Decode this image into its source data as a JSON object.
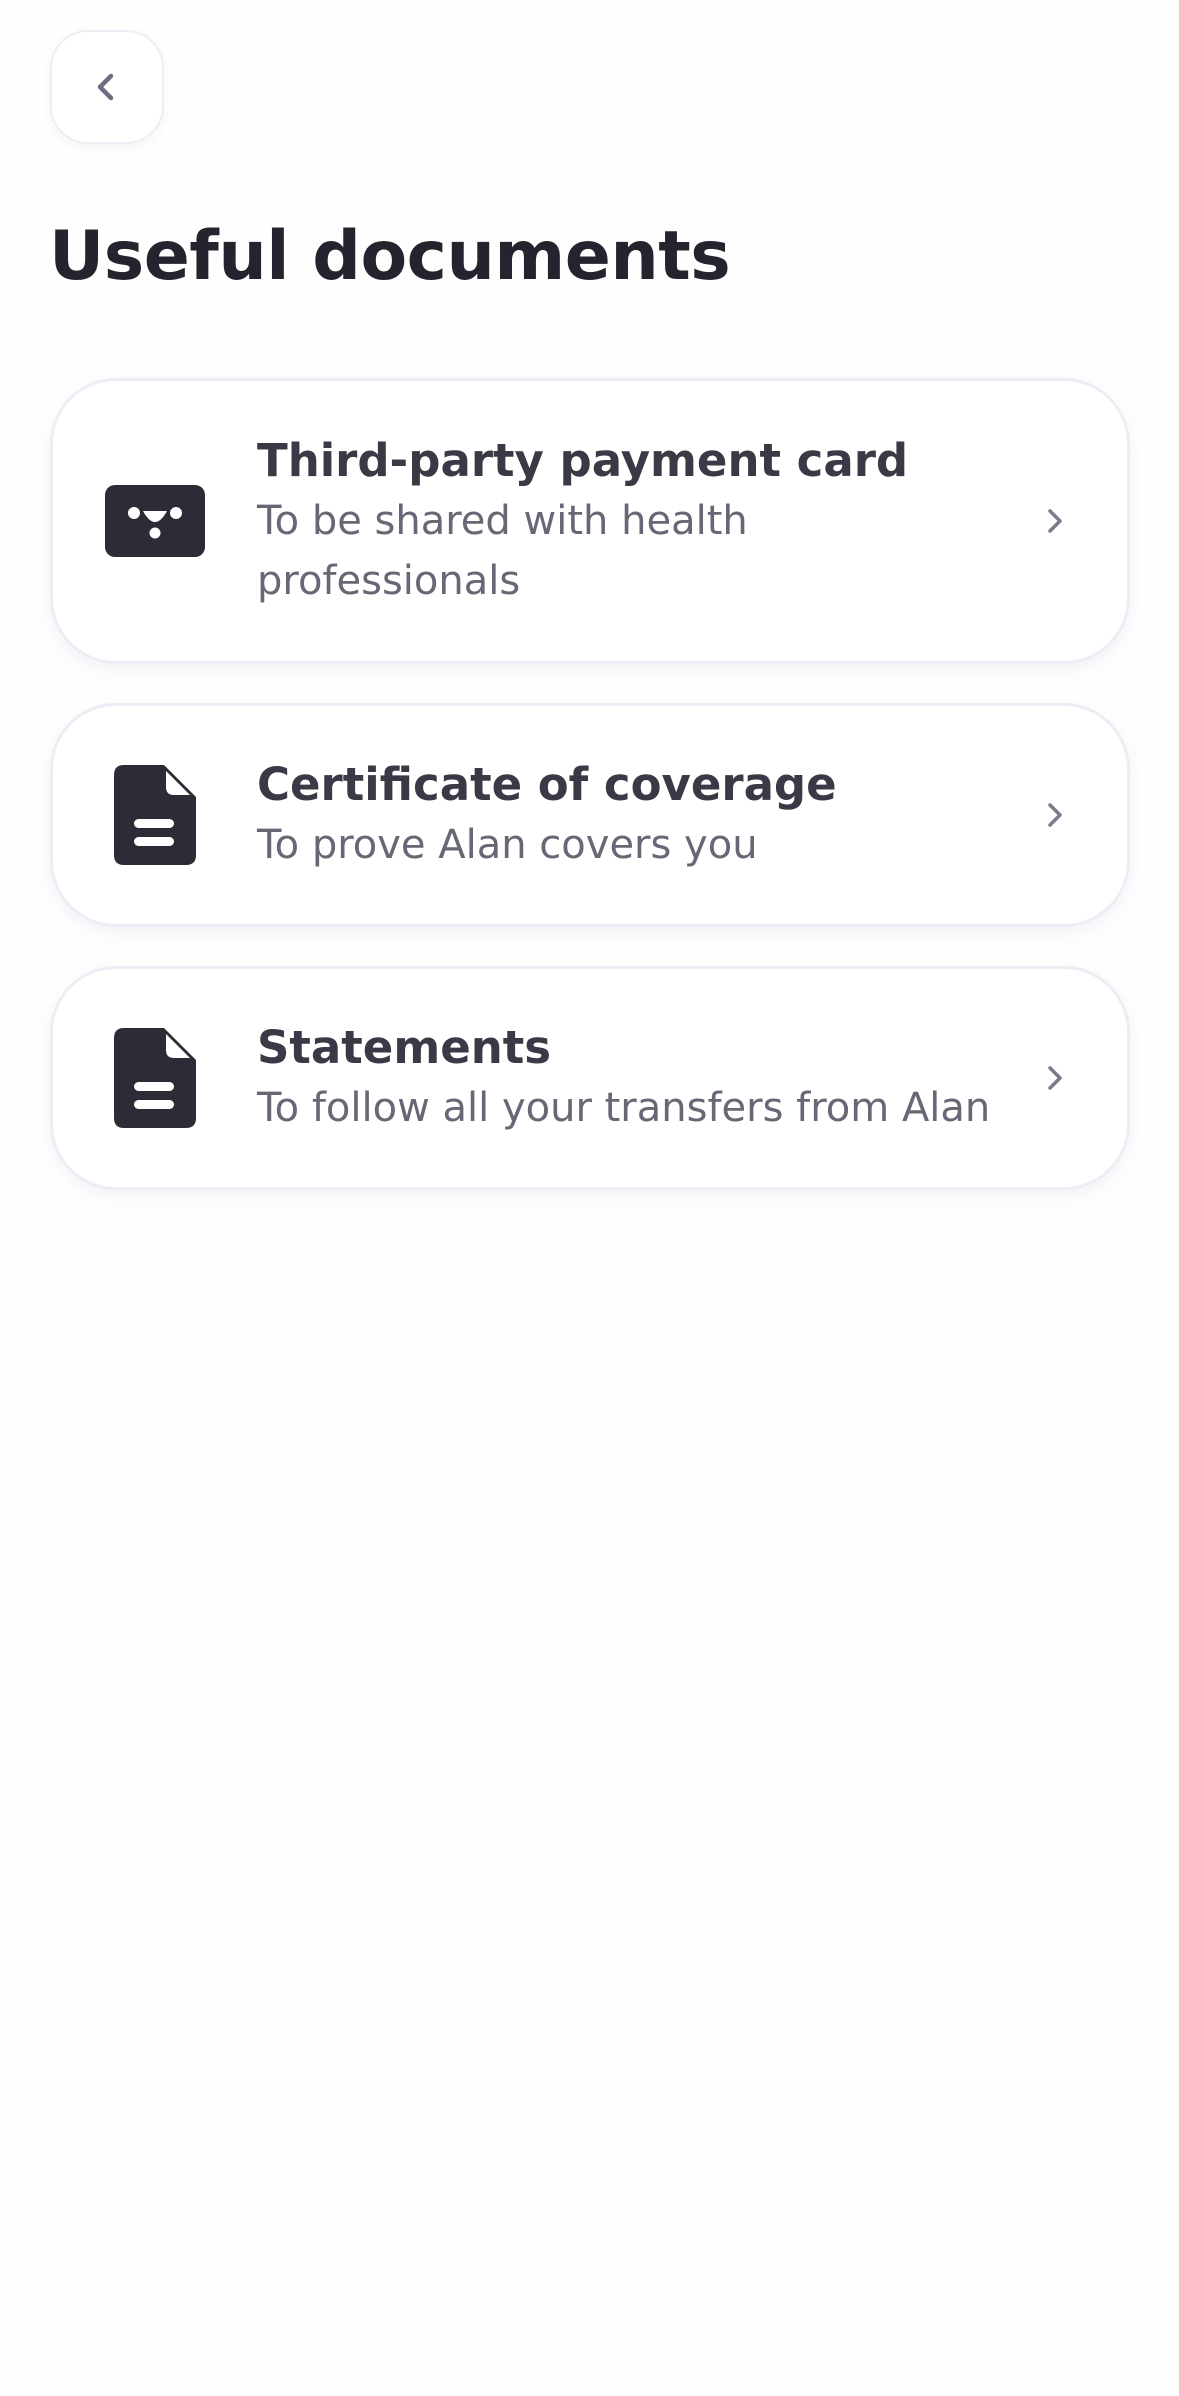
{
  "header": {
    "back_icon": "chevron-left-icon",
    "title": "Useful documents"
  },
  "documents": [
    {
      "icon": "id-card-icon",
      "title": "Third-party payment card",
      "description": "To be shared with health professionals"
    },
    {
      "icon": "document-icon",
      "title": "Certificate of coverage",
      "description": "To prove Alan covers you"
    },
    {
      "icon": "document-icon",
      "title": "Statements",
      "description": "To follow all your transfers from Alan"
    }
  ],
  "colors": {
    "background": "#FFFEFF",
    "card_border": "#EDEDF6",
    "title_text": "#24242E",
    "item_title": "#3A3A46",
    "item_description": "#676775",
    "icon_fill": "#2C2C36",
    "chevron": "#7A7A8C"
  }
}
